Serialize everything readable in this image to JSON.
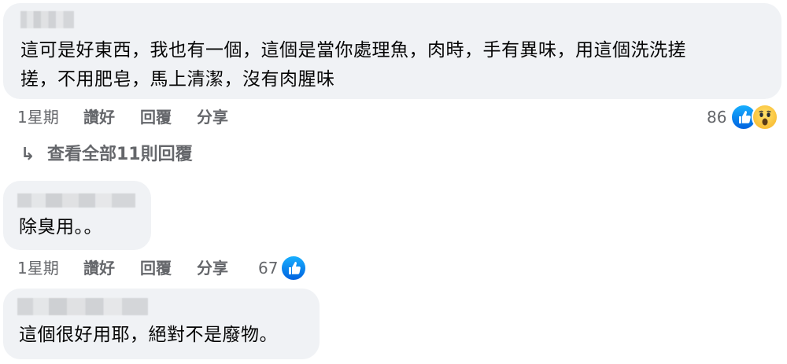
{
  "comments": [
    {
      "text_line1": "這可是好東西，我也有一個，這個是當你處理魚，肉時，手有異味，用這個洗洗搓",
      "text_line2": "搓，不用肥皂，馬上清潔，沒有肉腥味",
      "time": "1星期",
      "like_label": "讚好",
      "reply_label": "回覆",
      "share_label": "分享",
      "reaction_count": "86",
      "reactions": [
        "like-icon",
        "wow-icon"
      ]
    },
    {
      "text_line1": "除臭用。。",
      "time": "1星期",
      "like_label": "讚好",
      "reply_label": "回覆",
      "share_label": "分享",
      "reaction_count": "67",
      "reactions": [
        "like-icon"
      ]
    },
    {
      "text_line1": "這個很好用耶，絕對不是廢物。"
    }
  ],
  "view_replies": {
    "arrow": "↳",
    "label": "查看全部11則回覆"
  },
  "colors": {
    "bubble": "#f0f2f5",
    "meta_text": "#65676b",
    "like_blue": "#0866ff",
    "wow_yellow": "#f7b125"
  }
}
